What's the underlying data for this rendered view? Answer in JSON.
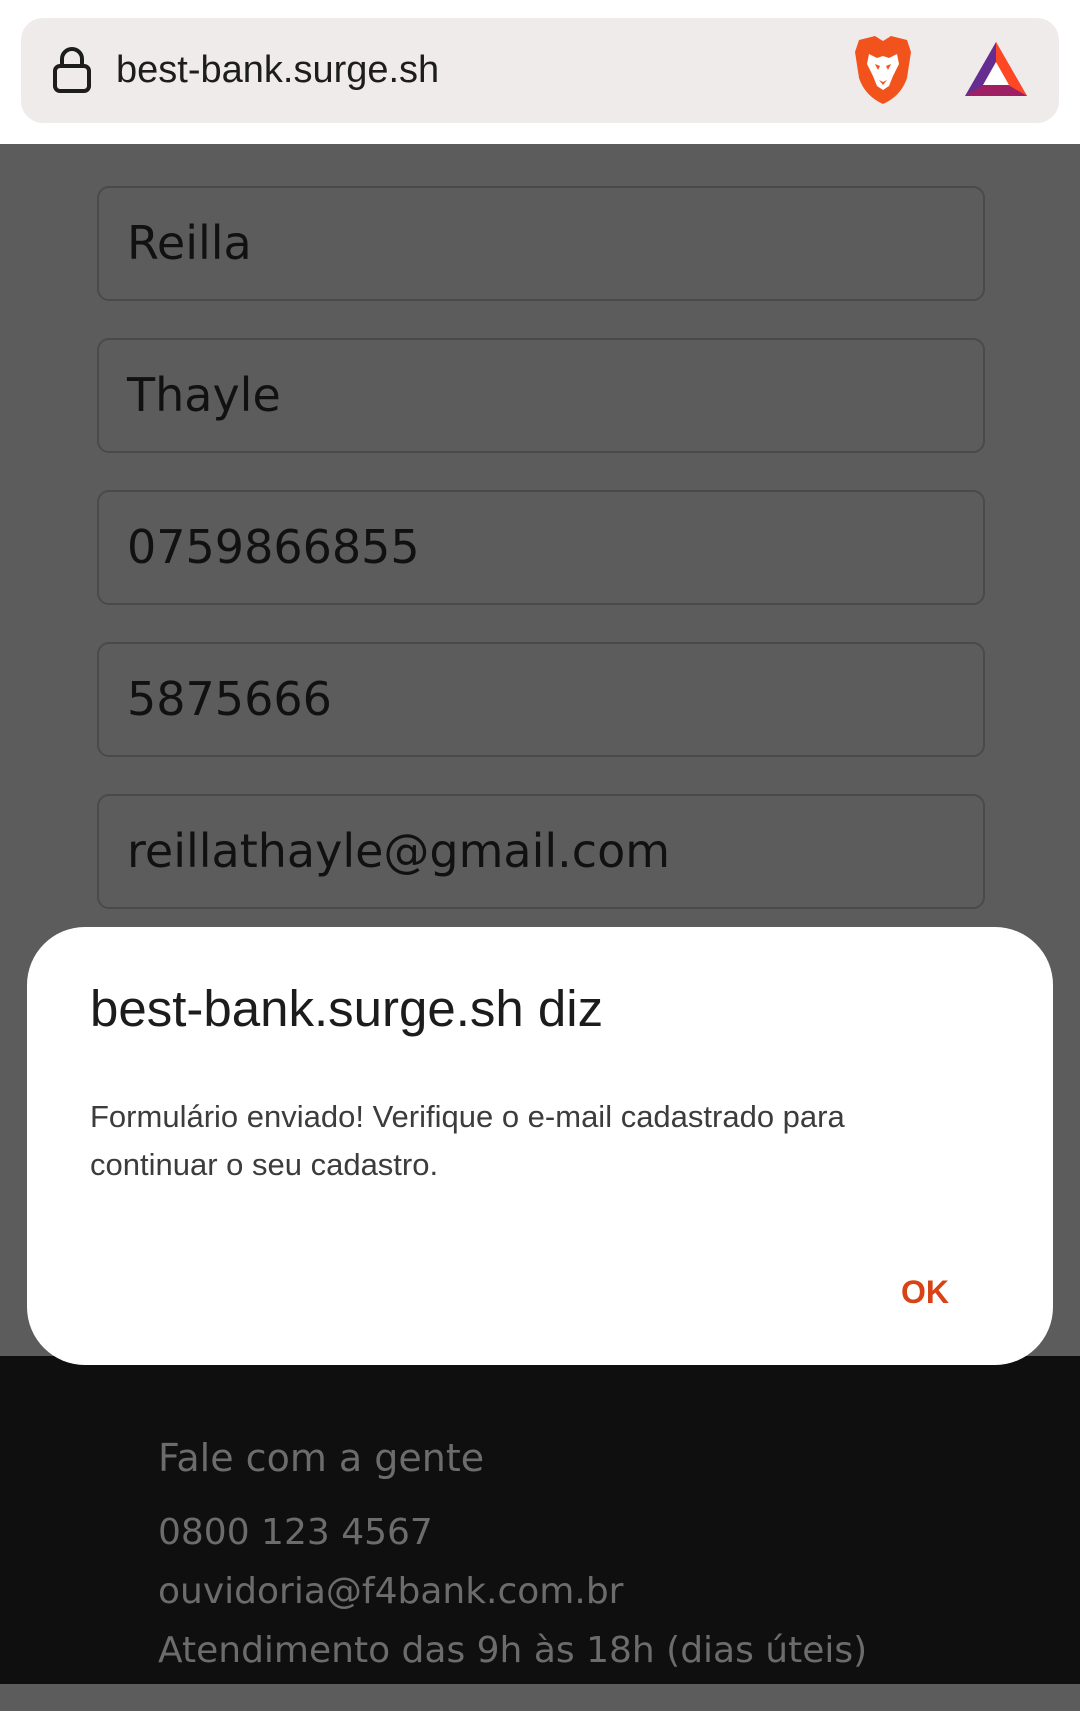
{
  "browser": {
    "url": "best-bank.surge.sh",
    "lock_icon": "lock-icon",
    "brave_icon": "brave-shield-icon",
    "rewards_icon": "bat-rewards-icon"
  },
  "form": {
    "first_name": "Reilla",
    "last_name": "Thayle",
    "phone": "0759866855",
    "code": "5875666",
    "email": "reillathayle@gmail.com"
  },
  "dialog": {
    "title": "best-bank.surge.sh diz",
    "message": "Formulário enviado! Verifique o e-mail cadastrado para continuar o seu cadastro.",
    "ok_label": "OK"
  },
  "footer": {
    "heading": "Fale com a gente",
    "phone": "0800 123 4567",
    "email": "ouvidoria@f4bank.com.br",
    "hours": "Atendimento das 9h às 18h (dias úteis)"
  },
  "colors": {
    "accent": "#d84315",
    "overlay": "#5c5c5c",
    "footer_bg": "#0f0f0f"
  }
}
